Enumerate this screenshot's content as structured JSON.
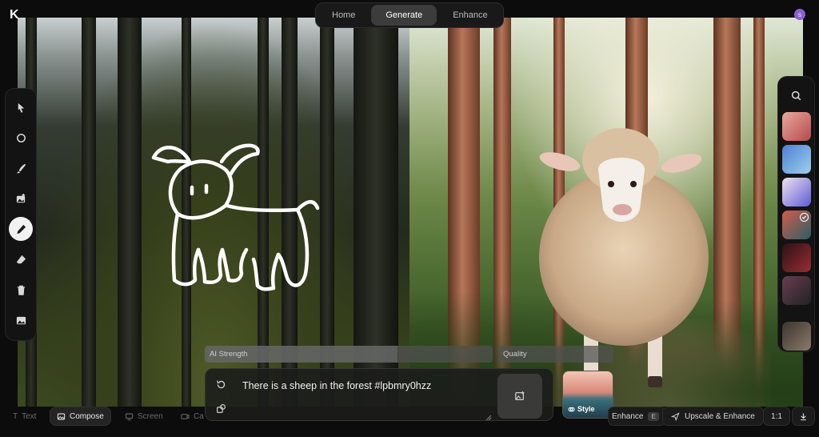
{
  "logo": {
    "glyph": "K"
  },
  "nav": {
    "tabs": [
      {
        "label": "Home"
      },
      {
        "label": "Generate"
      },
      {
        "label": "Enhance"
      }
    ],
    "active": "Generate"
  },
  "user": {
    "initial": "s",
    "color": "#8d5fd6"
  },
  "toolbar": {
    "tools": [
      "select-arrow-icon",
      "circle-icon",
      "brush-icon",
      "image-add-icon",
      "pen-icon",
      "eraser-icon",
      "trash-icon",
      "image-icon"
    ],
    "active": "pen-icon"
  },
  "controls": {
    "ai_strength_label": "AI Strength",
    "ai_strength_value": 0.67,
    "quality_label": "Quality",
    "quality_value": 0.0
  },
  "prompt": {
    "text": "There is a sheep in the forest #lpbmry0hzz"
  },
  "style": {
    "label": "Style"
  },
  "bottom_bar": {
    "text_label": "Text",
    "compose_label": "Compose",
    "screen_label": "Screen",
    "camera_label": "Ca",
    "enhance_label": "Enhance",
    "enhance_key": "E",
    "upscale_label": "Upscale & Enhance",
    "ratio_label": "1:1"
  },
  "gallery": {
    "thumbs": [
      {
        "colors": [
          "#e9a8a0",
          "#b54a4a"
        ]
      },
      {
        "colors": [
          "#4d7fd1",
          "#9dd0f0"
        ]
      },
      {
        "colors": [
          "#f2e3ef",
          "#5b5bd8"
        ]
      },
      {
        "colors": [
          "#d35c4b",
          "#2a5f66"
        ],
        "checked": true
      },
      {
        "colors": [
          "#2b1214",
          "#9b2b34"
        ]
      },
      {
        "colors": [
          "#6a3d52",
          "#222"
        ]
      },
      {
        "colors": [
          "#3b342f",
          "#8b7a6a"
        ]
      }
    ]
  }
}
